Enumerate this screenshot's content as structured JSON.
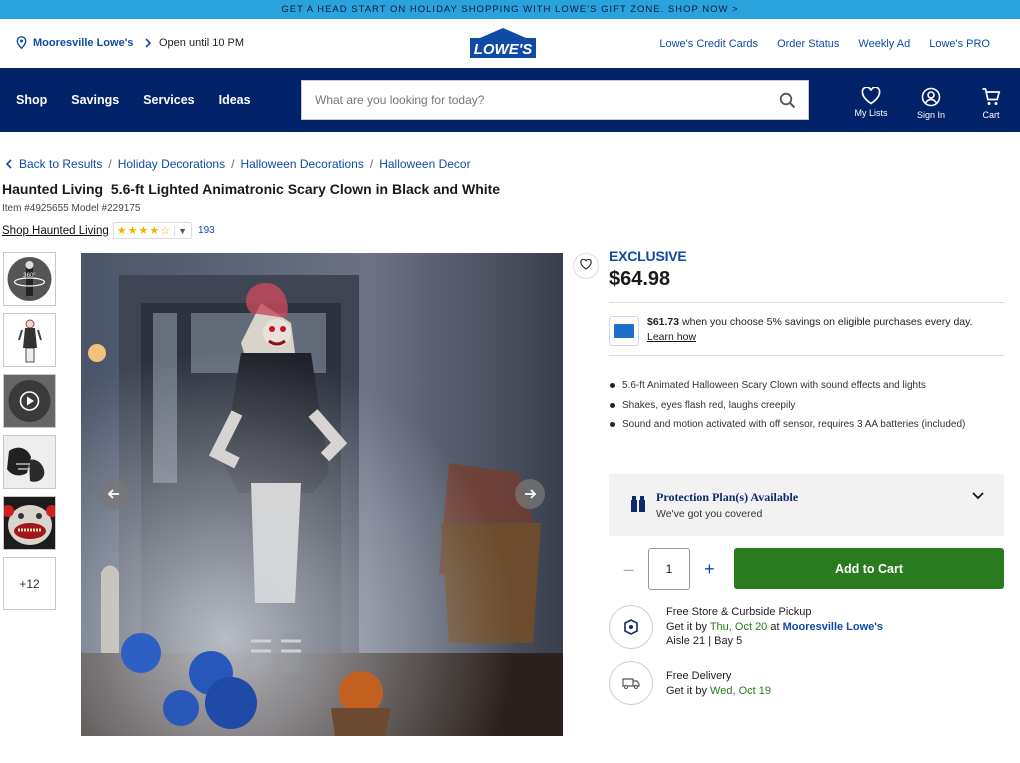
{
  "promo": {
    "text": "GET A HEAD START ON HOLIDAY SHOPPING WITH LOWE’S GIFT ZONE. SHOP NOW >"
  },
  "utility": {
    "store": "Mooresville Lowe's",
    "hours": "Open until 10 PM",
    "links": [
      "Lowe's Credit Cards",
      "Order Status",
      "Weekly Ad",
      "Lowe's PRO"
    ]
  },
  "logo": {
    "text": "LOWE'S"
  },
  "nav": {
    "menu": [
      "Shop",
      "Savings",
      "Services",
      "Ideas"
    ],
    "search_placeholder": "What are you looking for today?",
    "my_lists": "My Lists",
    "sign_in": "Sign In",
    "cart": "Cart"
  },
  "breadcrumb": {
    "back": "Back to Results",
    "items": [
      "Holiday Decorations",
      "Halloween Decorations",
      "Halloween Decor"
    ]
  },
  "product": {
    "title": "Haunted Living  5.6-ft Lighted Animatronic Scary Clown in Black and White",
    "item_line": "Item #4925655 Model #229175",
    "brand_link": "Shop Haunted Living",
    "rating": 4.5,
    "rating_stars": "★★★★☆",
    "review_count": "193",
    "more_images": "+12",
    "badge": "EXCLUSIVE",
    "price": "$64.98",
    "savings_price": "$61.73",
    "savings_text": " when you choose 5% savings on eligible purchases every day.",
    "learn_how": "Learn how",
    "bullets": [
      "5.6-ft Animated Halloween Scary Clown with sound effects and lights",
      "Shakes, eyes flash red, laughs creepily",
      "Sound and motion activated with off sensor, requires 3 AA batteries (included)"
    ],
    "protection_title": "Protection Plan(s) Available",
    "protection_sub": "We've got you covered",
    "quantity": "1",
    "add_to_cart": "Add to Cart"
  },
  "fulfillment": {
    "pickup_title": "Free Store & Curbside Pickup",
    "pickup_prefix": "Get it by ",
    "pickup_date": "Thu, Oct 20",
    "pickup_at": " at ",
    "pickup_store": "Mooresville Lowe's",
    "pickup_aisle": "Aisle 21 | Bay 5",
    "delivery_title": "Free Delivery",
    "delivery_prefix": "Get it by ",
    "delivery_date": "Wed, Oct 19"
  },
  "colors": {
    "promo": "#2aa3dc",
    "nav": "#012169",
    "link": "#0f4ba5",
    "cta": "#2a7a1f"
  }
}
